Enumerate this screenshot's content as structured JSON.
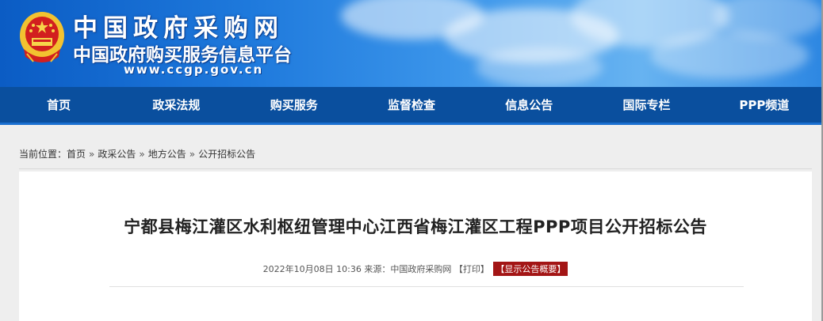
{
  "header": {
    "site_title": "中国政府采购网",
    "site_subtitle": "中国政府购买服务信息平台",
    "site_url": "www.ccgp.gov.cn",
    "emblem_icon": "national-emblem-icon"
  },
  "nav": {
    "items": [
      {
        "label": "首页"
      },
      {
        "label": "政采法规"
      },
      {
        "label": "购买服务"
      },
      {
        "label": "监督检查"
      },
      {
        "label": "信息公告"
      },
      {
        "label": "国际专栏"
      },
      {
        "label": "PPP频道"
      }
    ]
  },
  "breadcrumb": {
    "prefix": "当前位置：",
    "items": [
      "首页",
      "政采公告",
      "地方公告",
      "公开招标公告"
    ],
    "separator": "»"
  },
  "article": {
    "title": "宁都县梅江灌区水利枢纽管理中心江西省梅江灌区工程PPP项目公开招标公告",
    "datetime": "2022年10月08日 10:36",
    "source_label": "来源：",
    "source": "中国政府采购网",
    "print_label": "【打印】",
    "summary_label": "【显示公告概要】"
  },
  "colors": {
    "nav_bg": "#0a4f9e",
    "summary_bg": "#a31515",
    "banner_blue": "#1e79dc"
  }
}
